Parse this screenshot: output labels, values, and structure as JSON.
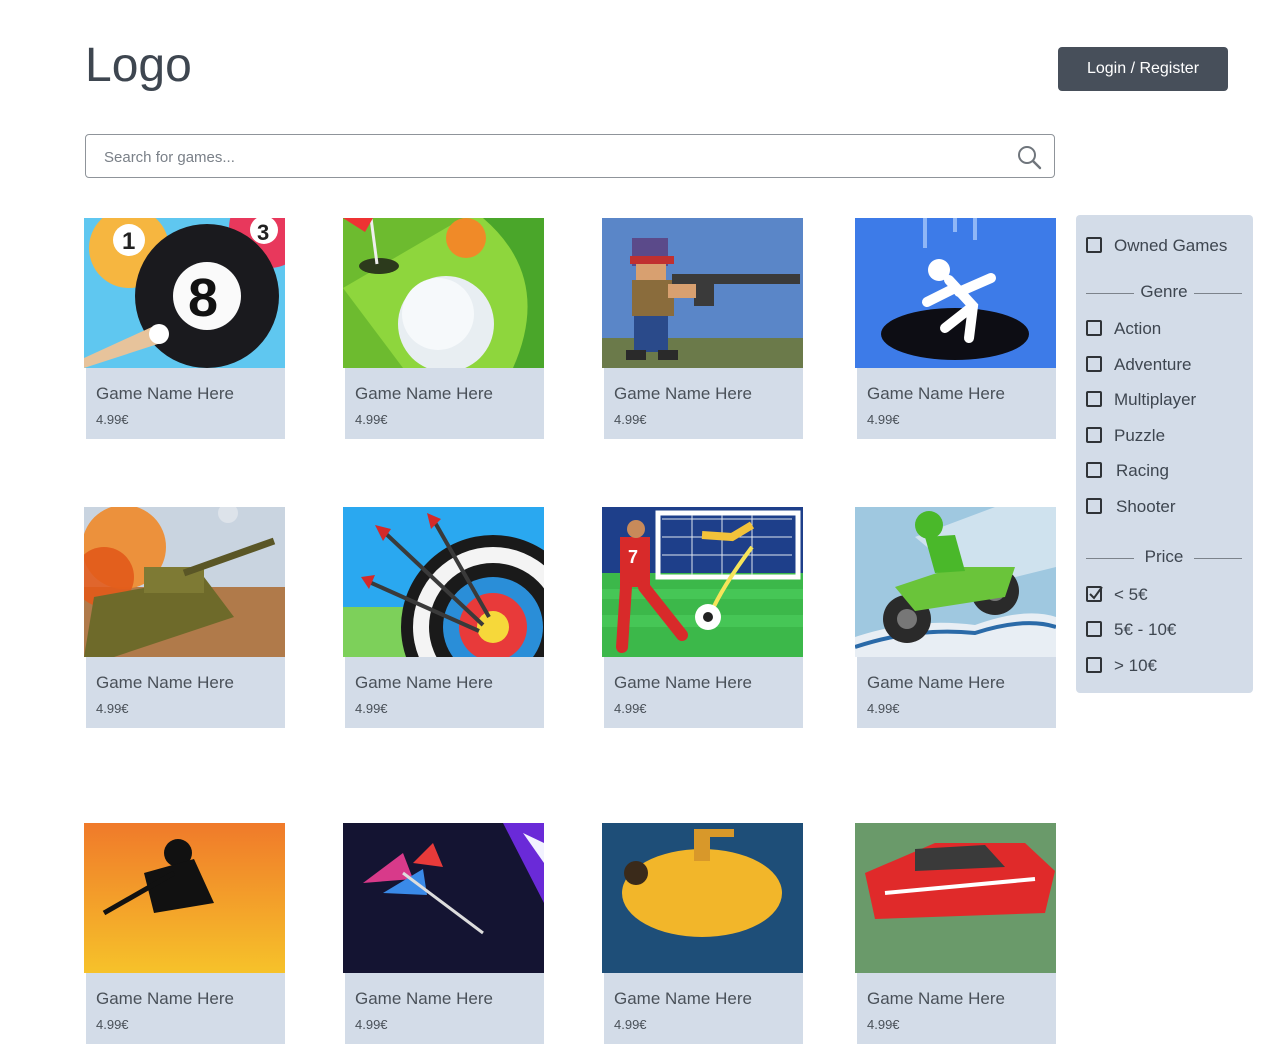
{
  "header": {
    "logo": "Logo",
    "login_label": "Login / Register"
  },
  "search": {
    "placeholder": "Search for games...",
    "value": ""
  },
  "games": [
    {
      "name": "Game Name Here",
      "price": "4.99€",
      "image": "billiards-8-ball"
    },
    {
      "name": "Game Name Here",
      "price": "4.99€",
      "image": "mini-golf"
    },
    {
      "name": "Game Name Here",
      "price": "4.99€",
      "image": "pixel-soldier-shooter"
    },
    {
      "name": "Game Name Here",
      "price": "4.99€",
      "image": "falling-stickman"
    },
    {
      "name": "Game Name Here",
      "price": "4.99€",
      "image": "tank-battle"
    },
    {
      "name": "Game Name Here",
      "price": "4.99€",
      "image": "archery-target"
    },
    {
      "name": "Game Name Here",
      "price": "4.99€",
      "image": "soccer-free-kick"
    },
    {
      "name": "Game Name Here",
      "price": "4.99€",
      "image": "atv-racing"
    },
    {
      "name": "Game Name Here",
      "price": "4.99€",
      "image": "ninja-sunset"
    },
    {
      "name": "Game Name Here",
      "price": "4.99€",
      "image": "darts"
    },
    {
      "name": "Game Name Here",
      "price": "4.99€",
      "image": "submarine"
    },
    {
      "name": "Game Name Here",
      "price": "4.99€",
      "image": "monster-truck"
    }
  ],
  "filters": {
    "owned": {
      "label": "Owned Games",
      "checked": false
    },
    "genre_heading": "Genre",
    "genres": [
      {
        "label": "Action",
        "checked": false
      },
      {
        "label": "Adventure",
        "checked": false
      },
      {
        "label": "Multiplayer",
        "checked": false
      },
      {
        "label": "Puzzle",
        "checked": false
      },
      {
        "label": "Racing",
        "checked": false
      },
      {
        "label": "Shooter",
        "checked": false
      }
    ],
    "price_heading": "Price",
    "prices": [
      {
        "label": "< 5€",
        "checked": true
      },
      {
        "label": "5€ - 10€",
        "checked": false
      },
      {
        "label": "> 10€",
        "checked": false
      }
    ]
  },
  "colors": {
    "primary_button": "#474f5a",
    "card_info_bg": "#d3dce8",
    "filter_bg": "#d3dce8",
    "text": "#3e4650"
  }
}
